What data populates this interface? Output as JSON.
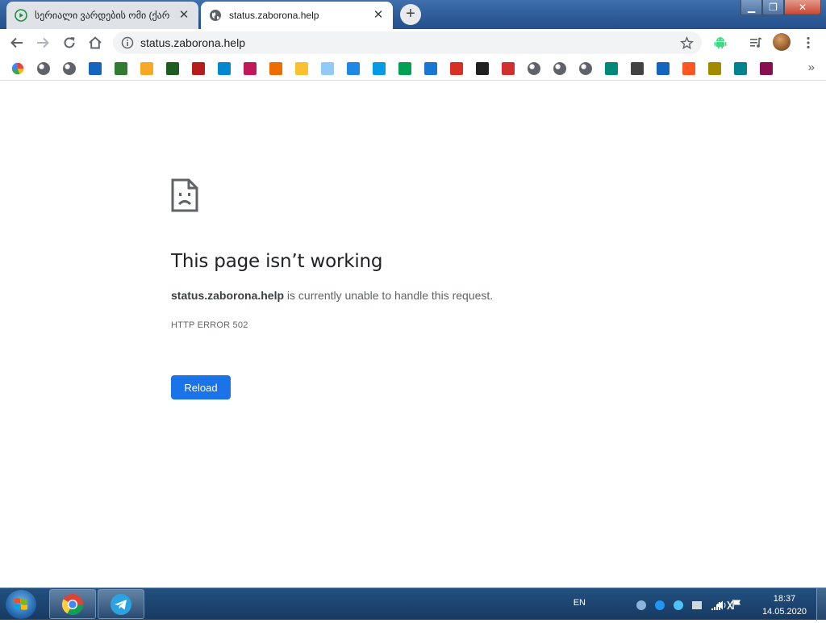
{
  "tabs": [
    {
      "title": "სერიალი ვარდების ომი (ქარ",
      "favicon": "play-circle-icon",
      "active": false
    },
    {
      "title": "status.zaborona.help",
      "favicon": "globe-icon",
      "active": true
    }
  ],
  "new_tab_label": "+",
  "toolbar": {
    "url": "status.zaborona.help",
    "icons": [
      "back-icon",
      "forward-icon",
      "reload-icon",
      "home-icon",
      "info-icon",
      "star-icon",
      "android-extension-icon",
      "media-control-icon",
      "profile-avatar",
      "menu-icon"
    ]
  },
  "bookmarks": {
    "icons": [
      "google-icon",
      "globe-icon",
      "globe-icon",
      "mail-icon",
      "ad-icon",
      "glasses-icon",
      "badge-icon",
      "c-icon",
      "triangle-icon",
      "l-icon",
      "t-icon",
      "wallet-icon",
      "chart-icon",
      "telegram-icon",
      "podcast-icon",
      "play-store-icon",
      "bird-icon",
      "gmail-icon",
      "film-icon",
      "my-icon",
      "globe-icon",
      "globe-icon",
      "globe-icon",
      "play-icon",
      "clapper-icon",
      "cross-icon",
      "f-icon",
      "star-badge-icon",
      "j-icon",
      "maltese-cross-icon"
    ],
    "colors": [
      "#4285f4",
      "#5f6368",
      "#5f6368",
      "#1565c0",
      "#2e7d32",
      "#f9a825",
      "#1b5e20",
      "#b71c1c",
      "#0288d1",
      "#c2185b",
      "#ef6c00",
      "#fbc02d",
      "#90caf9",
      "#1e88e5",
      "#039be5",
      "#00a152",
      "#1976d2",
      "#d93025",
      "#212121",
      "#d32f2f",
      "#5f6368",
      "#5f6368",
      "#5f6368",
      "#00897b",
      "#424242",
      "#1565c0",
      "#ff5722",
      "#a38b00",
      "#00838f",
      "#880e4f"
    ],
    "more": "»"
  },
  "error_page": {
    "title": "This page isn’t working",
    "host": "status.zaborona.help",
    "message": " is currently unable to handle this request.",
    "code": "HTTP ERROR 502",
    "reload_label": "Reload"
  },
  "taskbar": {
    "apps": [
      "chrome-icon",
      "telegram-icon"
    ],
    "language": "EN",
    "time": "18:37",
    "date": "14.05.2020"
  }
}
